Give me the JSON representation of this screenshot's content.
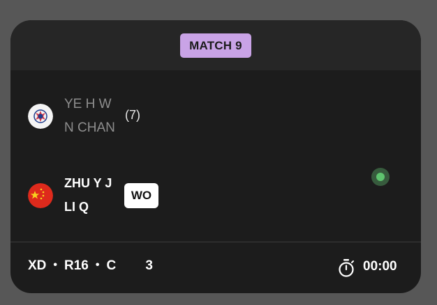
{
  "match": {
    "label": "MATCH 9"
  },
  "team1": {
    "flag": "chinese-taipei-flag-icon",
    "player1": "YE H W",
    "player2": "N CHAN",
    "seed": "(7)"
  },
  "team2": {
    "flag": "china-flag-icon",
    "player1": "ZHU Y J",
    "player2": "LI Q",
    "result_badge": "WO",
    "serving_indicator": "serve-dot-icon"
  },
  "footer": {
    "event": "XD",
    "round": "R16",
    "court": "C        3",
    "separator": "•",
    "timer": "00:00",
    "timer_icon": "stopwatch-icon"
  },
  "colors": {
    "badge_purple": "#c9a3e6",
    "card_bg": "#1c1c1c",
    "header_bg": "#262626",
    "serve_green": "#5ec46e"
  }
}
